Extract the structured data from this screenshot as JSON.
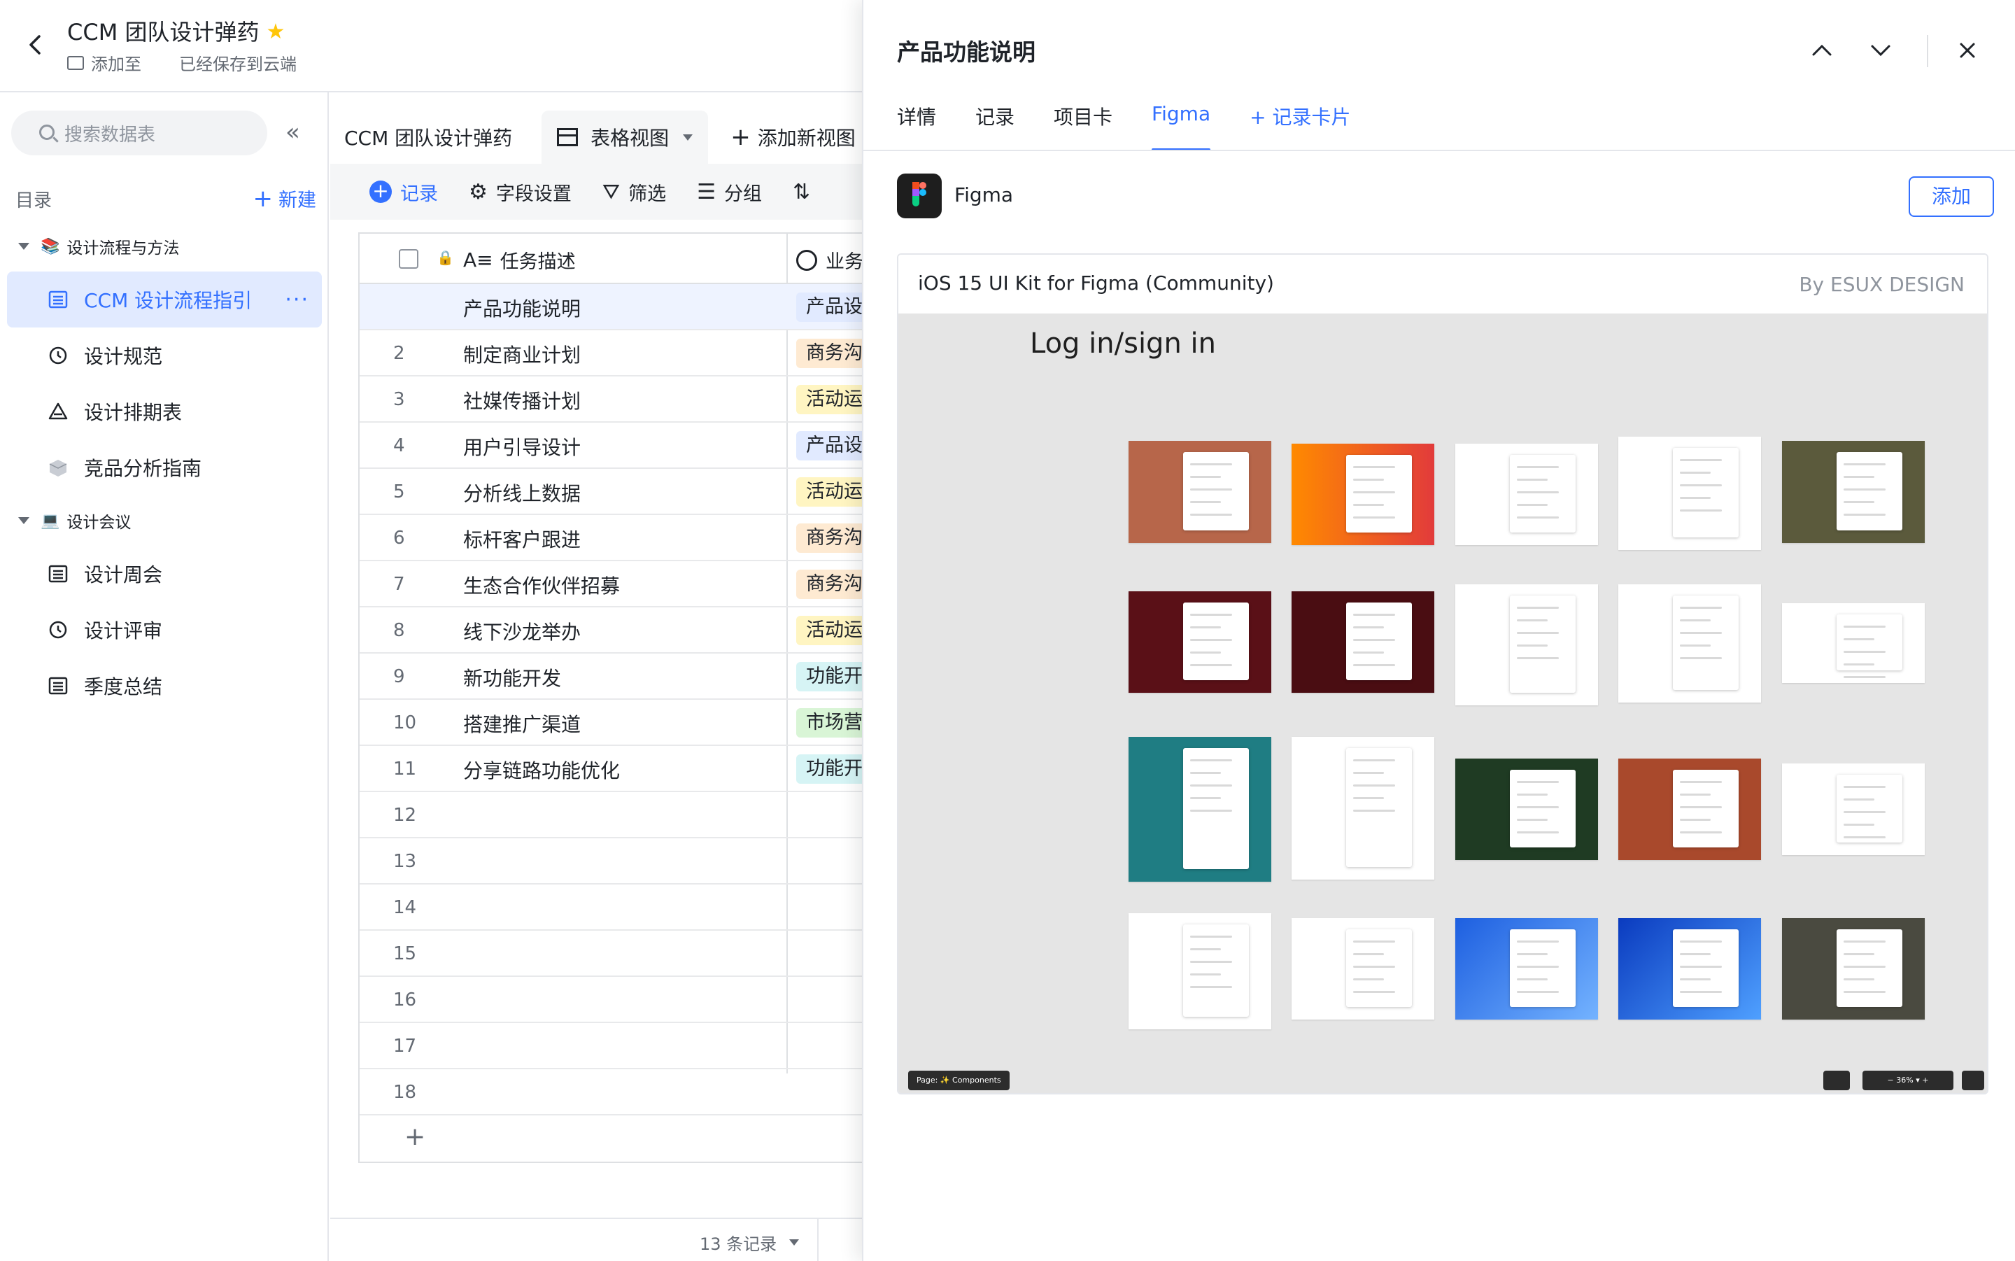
{
  "header": {
    "title": "CCM 团队设计弹药",
    "add_to": "添加至",
    "saved": "已经保存到云端"
  },
  "sidebar": {
    "search_placeholder": "搜索数据表",
    "catalog_label": "目录",
    "new_label": "新建",
    "groups": [
      {
        "label": "设计流程与方法",
        "emoji": "📚",
        "items": [
          {
            "label": "CCM 设计流程指引",
            "icon": "grid-table-icon",
            "active": true
          },
          {
            "label": "设计规范",
            "icon": "clock-icon"
          },
          {
            "label": "设计排期表",
            "icon": "gantt-icon"
          },
          {
            "label": "竞品分析指南",
            "icon": "box-icon"
          }
        ]
      },
      {
        "label": "设计会议",
        "emoji": "💻",
        "items": [
          {
            "label": "设计周会",
            "icon": "grid-table-icon"
          },
          {
            "label": "设计评审",
            "icon": "clock-icon"
          },
          {
            "label": "季度总结",
            "icon": "grid-table-icon"
          }
        ]
      }
    ]
  },
  "main": {
    "table_name": "CCM 团队设计弹药",
    "view_label": "表格视图",
    "add_view": "添加新视图",
    "toolbar": {
      "record": "记录",
      "fields": "字段设置",
      "filter": "筛选",
      "group": "分组"
    },
    "columns": [
      "任务描述",
      "业务"
    ],
    "rows": [
      {
        "num": "",
        "desc": "产品功能说明",
        "tag": "产品设",
        "color": "blue"
      },
      {
        "num": "2",
        "desc": "制定商业计划",
        "tag": "商务沟",
        "color": "orange"
      },
      {
        "num": "3",
        "desc": "社媒传播计划",
        "tag": "活动运",
        "color": "yellow"
      },
      {
        "num": "4",
        "desc": "用户引导设计",
        "tag": "产品设",
        "color": "blue"
      },
      {
        "num": "5",
        "desc": "分析线上数据",
        "tag": "活动运",
        "color": "yellow"
      },
      {
        "num": "6",
        "desc": "标杆客户跟进",
        "tag": "商务沟",
        "color": "orange"
      },
      {
        "num": "7",
        "desc": "生态合作伙伴招募",
        "tag": "商务沟",
        "color": "orange"
      },
      {
        "num": "8",
        "desc": "线下沙龙举办",
        "tag": "活动运",
        "color": "yellow"
      },
      {
        "num": "9",
        "desc": "新功能开发",
        "tag": "功能开",
        "color": "teal"
      },
      {
        "num": "10",
        "desc": "搭建推广渠道",
        "tag": "市场营",
        "color": "green"
      },
      {
        "num": "11",
        "desc": "分享链路功能优化",
        "tag": "功能开",
        "color": "teal"
      },
      {
        "num": "12",
        "desc": "",
        "tag": "",
        "color": ""
      },
      {
        "num": "13",
        "desc": "",
        "tag": "",
        "color": ""
      },
      {
        "num": "14",
        "desc": "",
        "tag": "",
        "color": ""
      },
      {
        "num": "15",
        "desc": "",
        "tag": "",
        "color": ""
      },
      {
        "num": "16",
        "desc": "",
        "tag": "",
        "color": ""
      },
      {
        "num": "17",
        "desc": "",
        "tag": "",
        "color": ""
      },
      {
        "num": "18",
        "desc": "",
        "tag": "",
        "color": ""
      }
    ],
    "record_count": "13 条记录"
  },
  "panel": {
    "title": "产品功能说明",
    "tabs": [
      "详情",
      "记录",
      "项目卡",
      "Figma"
    ],
    "active_tab": "Figma",
    "add_card": "记录卡片",
    "figma_app_name": "Figma",
    "add_button": "添加",
    "embed": {
      "title": "iOS 15 UI Kit for Figma (Community)",
      "by": "By ESUX DESIGN",
      "canvas_heading": "Log in/sign in",
      "page_label": "Page: ✨ Components",
      "zoom_label": "−   36%  ▾   +"
    }
  },
  "colors": {
    "accent": "#3370ff",
    "tag_blue": "#e1eaff",
    "tag_orange": "#feead2",
    "tag_yellow": "#fff5c2",
    "tag_teal": "#d6f4f5",
    "tag_green": "#d9f5d6"
  }
}
